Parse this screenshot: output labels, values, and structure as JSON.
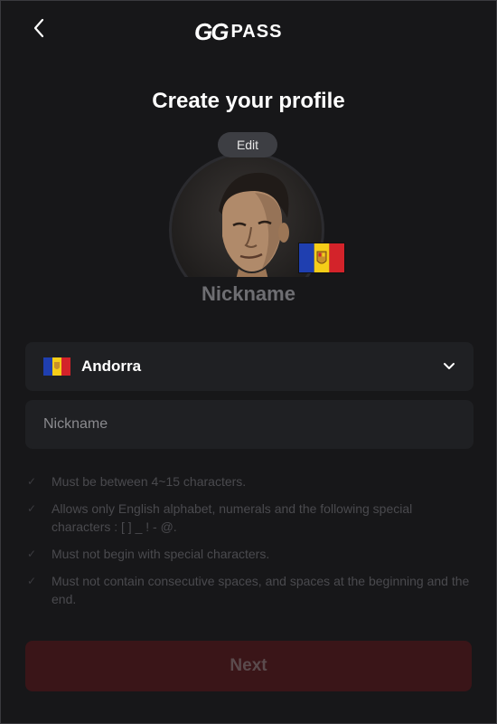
{
  "header": {
    "back_icon": "chevron-left-icon",
    "logo_gg": "GG",
    "logo_pass": "PASS"
  },
  "title": "Create your profile",
  "avatar": {
    "edit_label": "Edit",
    "flag_icon": "andorra-flag-icon"
  },
  "nickname_display": "Nickname",
  "country_select": {
    "value": "Andorra",
    "flag_icon": "andorra-flag-icon",
    "chevron_icon": "chevron-down-icon"
  },
  "nickname_input": {
    "placeholder": "Nickname",
    "value": ""
  },
  "rules": [
    "Must be between 4~15 characters.",
    "Allows only English alphabet, numerals and the following special characters : [ ] _ ! - @.",
    "Must not begin with special characters.",
    "Must not contain consecutive spaces, and spaces at the beginning and the end."
  ],
  "next_label": "Next",
  "colors": {
    "background": "#171719",
    "field_bg": "#1f2023",
    "next_disabled": "#3a1518",
    "andorra_blue": "#1f3fb0",
    "andorra_yellow": "#f5cd18",
    "andorra_red": "#d3232a"
  }
}
